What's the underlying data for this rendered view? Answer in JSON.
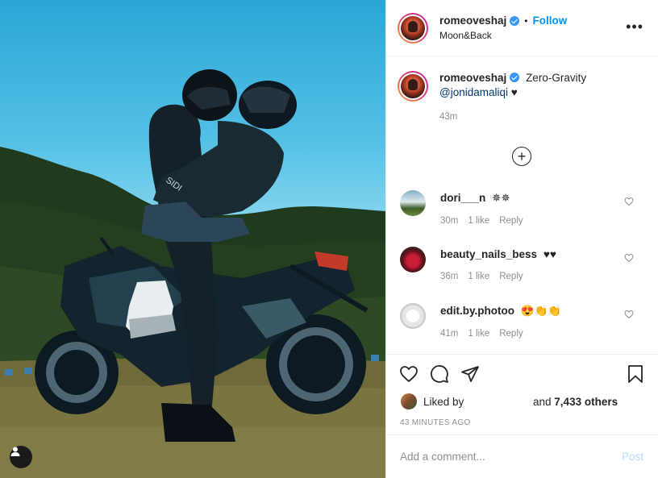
{
  "post": {
    "image_alt": "Couple embracing on a motorcycle in front of forested hills",
    "tag_icon": "user-icon"
  },
  "header": {
    "username": "romeoveshaj",
    "separator": "•",
    "follow_label": "Follow",
    "location": "Moon&Back",
    "more_icon": "•••"
  },
  "caption": {
    "username": "romeoveshaj",
    "text": "Zero-Gravity",
    "mention": "@jonidamaliqi",
    "emoji": "♥",
    "time": "43m"
  },
  "load_more_icon": "+",
  "comments": [
    {
      "username": "dori___n",
      "text": "✵✵",
      "time": "30m",
      "likes": "1 like",
      "reply": "Reply"
    },
    {
      "username": "beauty_nails_bess",
      "text": "♥♥",
      "time": "36m",
      "likes": "1 like",
      "reply": "Reply"
    },
    {
      "username": "edit.by.photoo",
      "text": "😍👏👏",
      "time": "41m",
      "likes": "1 like",
      "reply": "Reply"
    }
  ],
  "actions": {
    "liked_by_label": "Liked by",
    "and_label": "and",
    "likes_count": "7,433 others",
    "post_time": "43 MINUTES AGO"
  },
  "add_comment": {
    "placeholder": "Add a comment...",
    "post_label": "Post"
  },
  "colors": {
    "follow": "#0095f6",
    "verified": "#3897f0",
    "post_disabled": "#b2dffc",
    "muted": "#8e8e8e"
  }
}
